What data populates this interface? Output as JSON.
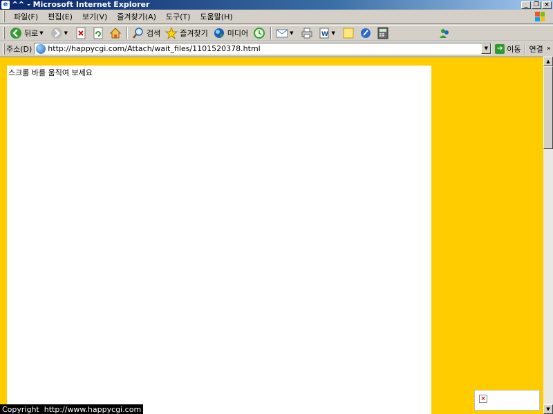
{
  "window": {
    "title": "^^ - Microsoft Internet Explorer",
    "controls": [
      "_",
      "❐",
      "×"
    ]
  },
  "menu": [
    "파일(F)",
    "편집(E)",
    "보기(V)",
    "즐겨찾기(A)",
    "도구(T)",
    "도움말(H)"
  ],
  "toolbar": {
    "back_label": "뒤로",
    "search_label": "검색",
    "favorites_label": "즐겨찾기",
    "media_label": "미디어"
  },
  "address": {
    "label": "주소(D)",
    "url": "http://happycgi.com/Attach/wait_files/1101520378.html",
    "go_label": "이동",
    "links_label": "연결"
  },
  "page": {
    "message": "스크롤 바를 움직여 보세요",
    "footer": "Copyright  http://www.happycgi.com"
  },
  "colors": {
    "page_background": "#ffcc00",
    "content_background": "#ffffff",
    "footer_background": "#000000"
  }
}
